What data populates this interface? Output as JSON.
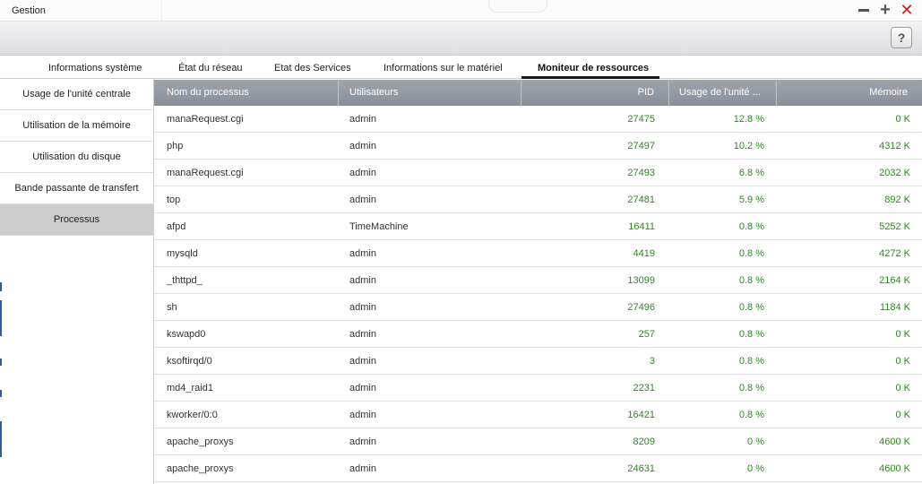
{
  "window": {
    "title": "Gestion",
    "help_label": "?"
  },
  "tabs": [
    {
      "label": "Informations système"
    },
    {
      "label": "État du réseau"
    },
    {
      "label": "Etat des Services"
    },
    {
      "label": "Informations sur le matériel"
    },
    {
      "label": "Moniteur de ressources",
      "active": true
    }
  ],
  "sidebar": {
    "items": [
      {
        "label": "Usage de l'unité centrale"
      },
      {
        "label": "Utilisation de la mémoire"
      },
      {
        "label": "Utilisation du disque"
      },
      {
        "label": "Bande passante de transfert"
      },
      {
        "label": "Processus",
        "active": true
      }
    ]
  },
  "table": {
    "columns": [
      "Nom du processus",
      "Utilisateurs",
      "PID",
      "Usage de l'unité ...",
      "Mémoire"
    ],
    "rows": [
      {
        "name": "manaRequest.cgi",
        "user": "admin",
        "pid": "27475",
        "cpu": "12.8 %",
        "mem": "0 K"
      },
      {
        "name": "php",
        "user": "admin",
        "pid": "27497",
        "cpu": "10.2 %",
        "mem": "4312 K"
      },
      {
        "name": "manaRequest.cgi",
        "user": "admin",
        "pid": "27493",
        "cpu": "6.8 %",
        "mem": "2032 K"
      },
      {
        "name": "top",
        "user": "admin",
        "pid": "27481",
        "cpu": "5.9 %",
        "mem": "892 K"
      },
      {
        "name": "afpd",
        "user": "TimeMachine",
        "pid": "16411",
        "cpu": "0.8 %",
        "mem": "5252 K"
      },
      {
        "name": "mysqld",
        "user": "admin",
        "pid": "4419",
        "cpu": "0.8 %",
        "mem": "4272 K"
      },
      {
        "name": "_thttpd_",
        "user": "admin",
        "pid": "13099",
        "cpu": "0.8 %",
        "mem": "2164 K"
      },
      {
        "name": "sh",
        "user": "admin",
        "pid": "27496",
        "cpu": "0.8 %",
        "mem": "1184 K"
      },
      {
        "name": "kswapd0",
        "user": "admin",
        "pid": "257",
        "cpu": "0.8 %",
        "mem": "0 K"
      },
      {
        "name": "ksoftirqd/0",
        "user": "admin",
        "pid": "3",
        "cpu": "0.8 %",
        "mem": "0 K"
      },
      {
        "name": "md4_raid1",
        "user": "admin",
        "pid": "2231",
        "cpu": "0.8 %",
        "mem": "0 K"
      },
      {
        "name": "kworker/0:0",
        "user": "admin",
        "pid": "16421",
        "cpu": "0.8 %",
        "mem": "0 K"
      },
      {
        "name": "apache_proxys",
        "user": "admin",
        "pid": "8209",
        "cpu": "0 %",
        "mem": "4600 K"
      },
      {
        "name": "apache_proxys",
        "user": "admin",
        "pid": "24631",
        "cpu": "0 %",
        "mem": "4600 K"
      }
    ]
  },
  "colors": {
    "value_green": "#2b8a1f",
    "header_gray": "#9ea4ad",
    "close_red": "#d21a1a"
  }
}
